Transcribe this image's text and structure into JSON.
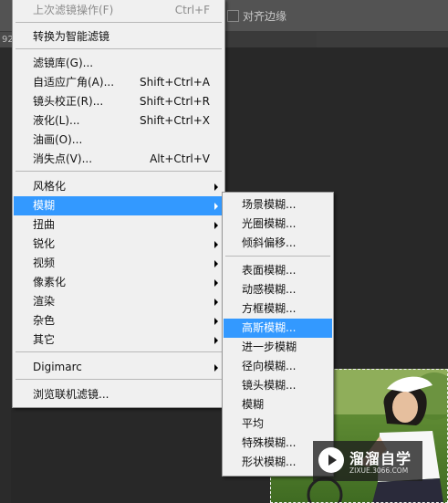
{
  "options_bar": {
    "align_edges_label": "对齐边缘",
    "align_edges_checked": false
  },
  "tab_strip": {
    "doc_tab_text": "92"
  },
  "filter_menu": {
    "items": [
      {
        "label": "上次滤镜操作(F)",
        "shortcut": "Ctrl+F",
        "disabled": true
      },
      {
        "label": "转换为智能滤镜"
      },
      {
        "label": "滤镜库(G)..."
      },
      {
        "label": "自适应广角(A)...",
        "shortcut": "Shift+Ctrl+A"
      },
      {
        "label": "镜头校正(R)...",
        "shortcut": "Shift+Ctrl+R"
      },
      {
        "label": "液化(L)...",
        "shortcut": "Shift+Ctrl+X"
      },
      {
        "label": "油画(O)..."
      },
      {
        "label": "消失点(V)...",
        "shortcut": "Alt+Ctrl+V"
      },
      {
        "label": "风格化"
      },
      {
        "label": "模糊",
        "highlighted": true
      },
      {
        "label": "扭曲"
      },
      {
        "label": "锐化"
      },
      {
        "label": "视频"
      },
      {
        "label": "像素化"
      },
      {
        "label": "渲染"
      },
      {
        "label": "杂色"
      },
      {
        "label": "其它"
      },
      {
        "label": "Digimarc"
      },
      {
        "label": "浏览联机滤镜..."
      }
    ]
  },
  "blur_submenu": {
    "items": [
      {
        "label": "场景模糊..."
      },
      {
        "label": "光圈模糊..."
      },
      {
        "label": "倾斜偏移..."
      },
      {
        "label": "表面模糊..."
      },
      {
        "label": "动感模糊..."
      },
      {
        "label": "方框模糊..."
      },
      {
        "label": "高斯模糊...",
        "highlighted": true
      },
      {
        "label": "进一步模糊"
      },
      {
        "label": "径向模糊..."
      },
      {
        "label": "镜头模糊..."
      },
      {
        "label": "模糊"
      },
      {
        "label": "平均"
      },
      {
        "label": "特殊模糊..."
      },
      {
        "label": "形状模糊..."
      }
    ]
  },
  "watermark": {
    "brand": "溜溜自学",
    "site": "ZIXUE.3066.COM"
  },
  "colors": {
    "menu_bg": "#f0f0f0",
    "highlight": "#3399ff",
    "app_bg": "#282828"
  }
}
